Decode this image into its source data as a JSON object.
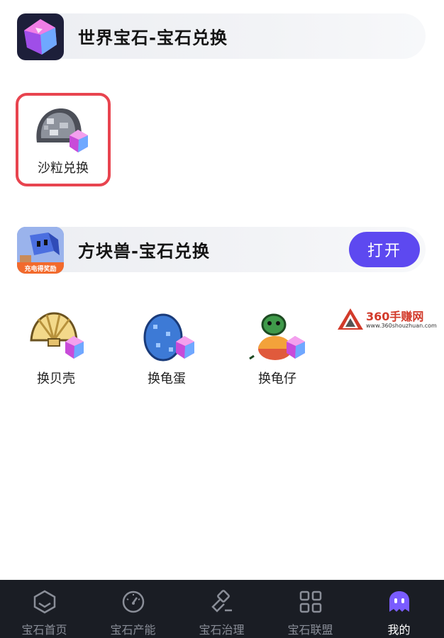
{
  "sections": [
    {
      "title": "世界宝石-宝石兑换",
      "items": [
        {
          "label": "沙粒兑换",
          "icon": "sand-gem-icon"
        }
      ]
    },
    {
      "title": "方块兽-宝石兑换",
      "app_badge": "充电得奖励",
      "open_label": "打开",
      "items": [
        {
          "label": "换贝壳",
          "icon": "shell-gem-icon"
        },
        {
          "label": "换龟蛋",
          "icon": "turtle-egg-gem-icon"
        },
        {
          "label": "换龟仔",
          "icon": "baby-turtle-gem-icon"
        }
      ]
    }
  ],
  "watermark": {
    "title": "360手赚网",
    "url": "www.360shouzhuan.com"
  },
  "tabbar": [
    {
      "label": "宝石首页",
      "icon": "hexagon-icon",
      "active": false
    },
    {
      "label": "宝石产能",
      "icon": "gauge-icon",
      "active": false
    },
    {
      "label": "宝石治理",
      "icon": "hammer-icon",
      "active": false
    },
    {
      "label": "宝石联盟",
      "icon": "grid-icon",
      "active": false
    },
    {
      "label": "我的",
      "icon": "ghost-avatar-icon",
      "active": true
    }
  ],
  "colors": {
    "accent": "#5d49f0",
    "highlight_border": "#e8444f",
    "tabbar_bg": "#1a1d24"
  }
}
